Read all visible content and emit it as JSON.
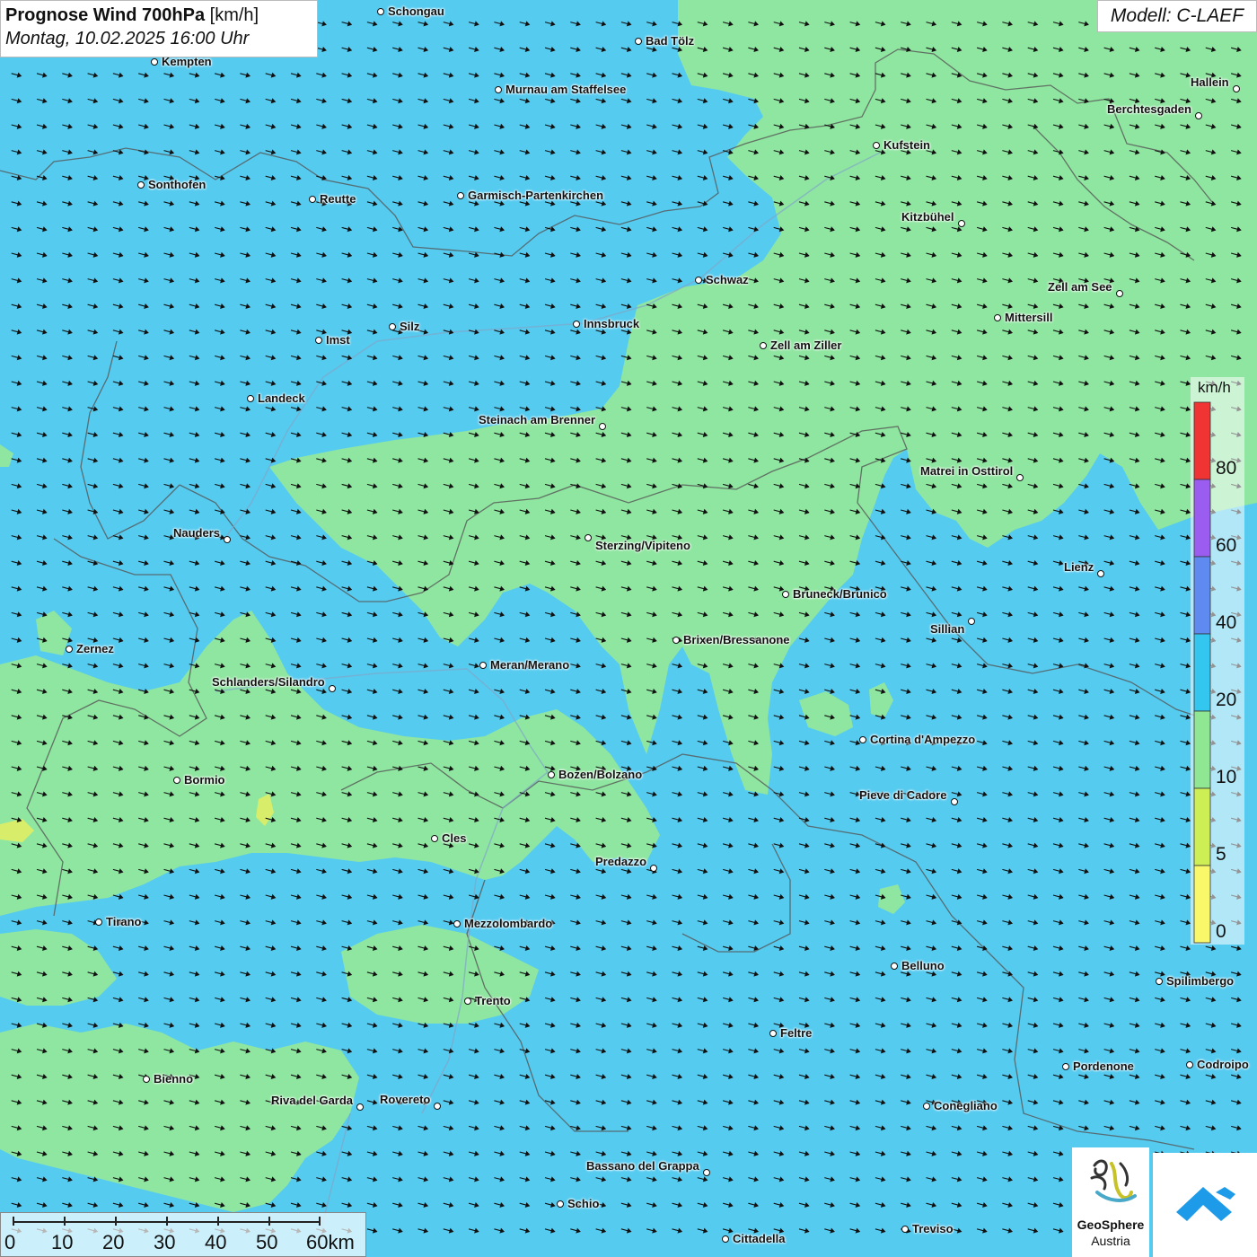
{
  "header": {
    "title": "Prognose Wind 700hPa",
    "unit_label": "[km/h]",
    "subtitle": "Montag, 10.02.2025 16:00 Uhr"
  },
  "model": {
    "label": "Modell: C-LAEF"
  },
  "legend": {
    "unit": "km/h",
    "labels": [
      "80",
      "60",
      "40",
      "20",
      "10",
      "5",
      "0"
    ],
    "colors": [
      "#f03333",
      "#9b5cf0",
      "#5f8af0",
      "#33c6ee",
      "#8fe693",
      "#cdee55",
      "#f8f86a"
    ]
  },
  "colors": {
    "field_blue": "#56cbf0",
    "field_green": "#8fe6a0",
    "field_yellow": "#d8ee6a"
  },
  "cities": [
    {
      "name": "Schongau"
    },
    {
      "name": "Bad Tölz"
    },
    {
      "name": "Kempten"
    },
    {
      "name": "Murnau am Staffelsee"
    },
    {
      "name": "Hallein"
    },
    {
      "name": "Berchtesgaden"
    },
    {
      "name": "Kufstein"
    },
    {
      "name": "Sonthofen"
    },
    {
      "name": "Reutte"
    },
    {
      "name": "Garmisch-Partenkirchen"
    },
    {
      "name": "Kitzbühel"
    },
    {
      "name": "Schwaz"
    },
    {
      "name": "Zell am See"
    },
    {
      "name": "Mittersill"
    },
    {
      "name": "Innsbruck"
    },
    {
      "name": "Silz"
    },
    {
      "name": "Imst"
    },
    {
      "name": "Zell am Ziller"
    },
    {
      "name": "Landeck"
    },
    {
      "name": "Steinach am Brenner"
    },
    {
      "name": "Matrei in Osttirol"
    },
    {
      "name": "Nauders"
    },
    {
      "name": "Sterzing/Vipiteno"
    },
    {
      "name": "Lienz"
    },
    {
      "name": "Bruneck/Brunico"
    },
    {
      "name": "Sillian"
    },
    {
      "name": "Zernez"
    },
    {
      "name": "Brixen/Bressanone"
    },
    {
      "name": "Meran/Merano"
    },
    {
      "name": "Schlanders/Silandro"
    },
    {
      "name": "Cortina d'Ampezzo"
    },
    {
      "name": "Bozen/Bolzano"
    },
    {
      "name": "Bormio"
    },
    {
      "name": "Pieve di Cadore"
    },
    {
      "name": "Cles"
    },
    {
      "name": "Predazzo"
    },
    {
      "name": "Tirano"
    },
    {
      "name": "Mezzolombardo"
    },
    {
      "name": "Belluno"
    },
    {
      "name": "Spilimbergo"
    },
    {
      "name": "Trento"
    },
    {
      "name": "Feltre"
    },
    {
      "name": "Pordenone"
    },
    {
      "name": "Codroipo"
    },
    {
      "name": "Bienno"
    },
    {
      "name": "Riva del Garda"
    },
    {
      "name": "Rovereto"
    },
    {
      "name": "Conegliano"
    },
    {
      "name": "Bassano del Grappa"
    },
    {
      "name": "Schio"
    },
    {
      "name": "Treviso"
    },
    {
      "name": "Cittadella"
    }
  ],
  "scale_bar": {
    "labels": [
      "0",
      "10",
      "20",
      "30",
      "40",
      "50",
      "60km"
    ]
  },
  "logo": {
    "name_line1": "GeoSphere",
    "name_line2": "Austria"
  },
  "wind": {
    "direction_deg_from": 285
  }
}
